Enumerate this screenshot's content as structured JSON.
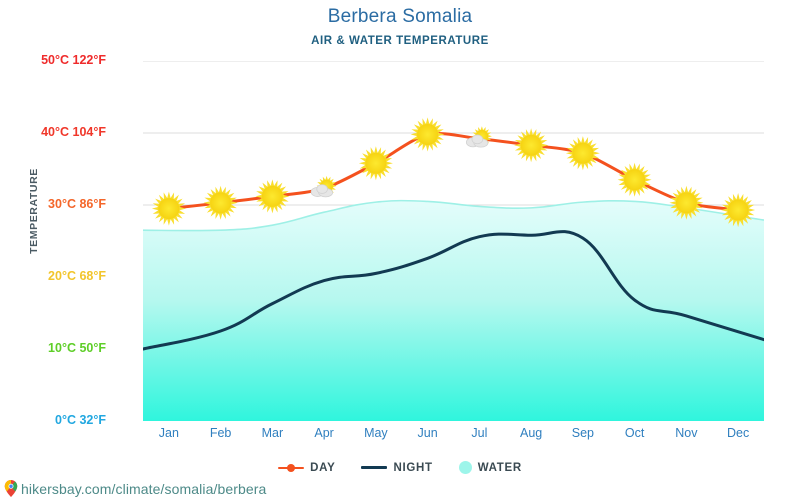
{
  "header": {
    "title": "Berbera Somalia",
    "subtitle": "AIR & WATER TEMPERATURE"
  },
  "axis": {
    "ylabel": "TEMPERATURE",
    "yticks": [
      {
        "label": "50°C 122°F",
        "value": 50,
        "color": "#ef2b2b"
      },
      {
        "label": "40°C 104°F",
        "value": 40,
        "color": "#f0372a"
      },
      {
        "label": "30°C 86°F",
        "value": 30,
        "color": "#f4662a"
      },
      {
        "label": "20°C 68°F",
        "value": 20,
        "color": "#f2c52c"
      },
      {
        "label": "10°C 50°F",
        "value": 10,
        "color": "#5ece28"
      },
      {
        "label": "0°C 32°F",
        "value": 0,
        "color": "#21a7e0"
      }
    ]
  },
  "legend": [
    {
      "label": "DAY",
      "icon": "line-marker-icon",
      "color": "#f4511e"
    },
    {
      "label": "NIGHT",
      "icon": "line-icon",
      "color": "#123a52"
    },
    {
      "label": "WATER",
      "icon": "circle-icon",
      "color": "#9df5ea"
    }
  ],
  "footer": {
    "icon": "location-pin-icon",
    "text": "hikersbay.com/climate/somalia/berbera"
  },
  "colors": {
    "day_line": "#f4511e",
    "night_line": "#123a52",
    "water_line": "#9ef0e6",
    "water_fill_top": "#e2fcfa",
    "water_fill_bottom": "#2ff5dd",
    "grid": "#dcdcdc",
    "title": "#2b6ca3",
    "subtitle": "#1f5f80",
    "xtick": "#2f7fbf",
    "sun": "#f9de2e",
    "cloud": "#e3e3e3"
  },
  "chart_data": {
    "type": "line",
    "title": "Berbera Somalia",
    "subtitle": "AIR & WATER TEMPERATURE",
    "xlabel": "",
    "ylabel": "TEMPERATURE",
    "ylim": [
      0,
      50
    ],
    "ytick_values": [
      0,
      10,
      20,
      30,
      40,
      50
    ],
    "grid": true,
    "legend_position": "bottom",
    "categories": [
      "Jan",
      "Feb",
      "Mar",
      "Apr",
      "May",
      "Jun",
      "Jul",
      "Aug",
      "Sep",
      "Oct",
      "Nov",
      "Dec"
    ],
    "series": [
      {
        "name": "DAY",
        "color": "#f4511e",
        "values": [
          29.5,
          30.3,
          31.2,
          32.3,
          35.8,
          39.8,
          39.2,
          38.3,
          37.2,
          33.5,
          30.3,
          29.3
        ],
        "markers": [
          "sun",
          "sun",
          "sun",
          "sun-cloud",
          "sun",
          "sun",
          "sun-cloud",
          "sun",
          "sun",
          "sun",
          "sun",
          "sun"
        ]
      },
      {
        "name": "NIGHT",
        "color": "#123a52",
        "values": [
          10.0,
          12.5,
          16.3,
          19.5,
          20.5,
          22.6,
          25.6,
          25.8,
          25.4,
          16.8,
          14.6,
          11.3
        ]
      },
      {
        "name": "WATER",
        "color": "#9ef0e6",
        "fill": true,
        "values": [
          26.5,
          26.5,
          27.2,
          29.0,
          30.4,
          30.5,
          29.8,
          29.6,
          30.4,
          30.5,
          29.6,
          27.9
        ]
      }
    ]
  }
}
